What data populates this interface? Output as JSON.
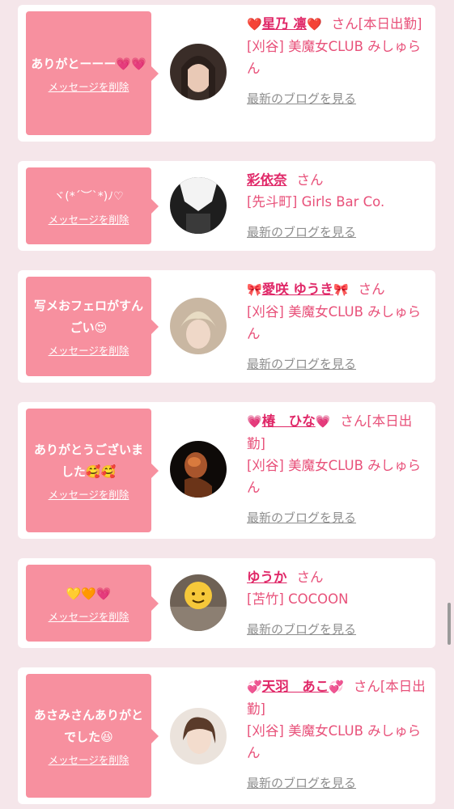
{
  "cards": [
    {
      "message": "ありがとーーー💗💗",
      "delete_label": "メッセージを削除",
      "name_prefix": "❤️",
      "name": "星乃 凛",
      "name_suffix_emoji": "❤️",
      "honorific": "さん[本日出勤]",
      "shop": "[刈谷] 美魔女CLUB みしゅらん",
      "blog_link": "最新のブログを見る"
    },
    {
      "message": "ヾ(*´︶`*)ﾉ♡",
      "delete_label": "メッセージを削除",
      "name_prefix": "",
      "name": "彩依奈",
      "name_suffix_emoji": "",
      "honorific": "さん",
      "shop": "[先斗町] Girls Bar Co.",
      "blog_link": "最新のブログを見る"
    },
    {
      "message": "写メおフェロがすんごい😍",
      "delete_label": "メッセージを削除",
      "name_prefix": "🎀",
      "name": "愛咲 ゆうき",
      "name_suffix_emoji": "🎀",
      "honorific": "さん",
      "shop": "[刈谷] 美魔女CLUB みしゅらん",
      "blog_link": "最新のブログを見る"
    },
    {
      "message": "ありがとうございました🥰🥰",
      "delete_label": "メッセージを削除",
      "name_prefix": "💗",
      "name": "椿　ひな",
      "name_suffix_emoji": "💗",
      "honorific": "さん[本日出勤]",
      "shop": "[刈谷] 美魔女CLUB みしゅらん",
      "blog_link": "最新のブログを見る"
    },
    {
      "message": "💛🧡💗",
      "delete_label": "メッセージを削除",
      "name_prefix": "",
      "name": "ゆうか",
      "name_suffix_emoji": "",
      "honorific": "さん",
      "shop": "[苫竹] COCOON",
      "blog_link": "最新のブログを見る"
    },
    {
      "message": "あさみさんありがとでした😆",
      "delete_label": "メッセージを削除",
      "name_prefix": "💞",
      "name": "天羽　あこ",
      "name_suffix_emoji": "💞",
      "honorific": "さん[本日出勤]",
      "shop": "[刈谷] 美魔女CLUB みしゅらん",
      "blog_link": "最新のブログを見る"
    }
  ],
  "colors": {
    "page_bg": "#f5e6ea",
    "message_bg": "#f7909f",
    "name": "#e02868",
    "text_pink": "#e8517a",
    "link_gray": "#8e8e8e"
  },
  "icons": [
    "avatar-photo"
  ]
}
